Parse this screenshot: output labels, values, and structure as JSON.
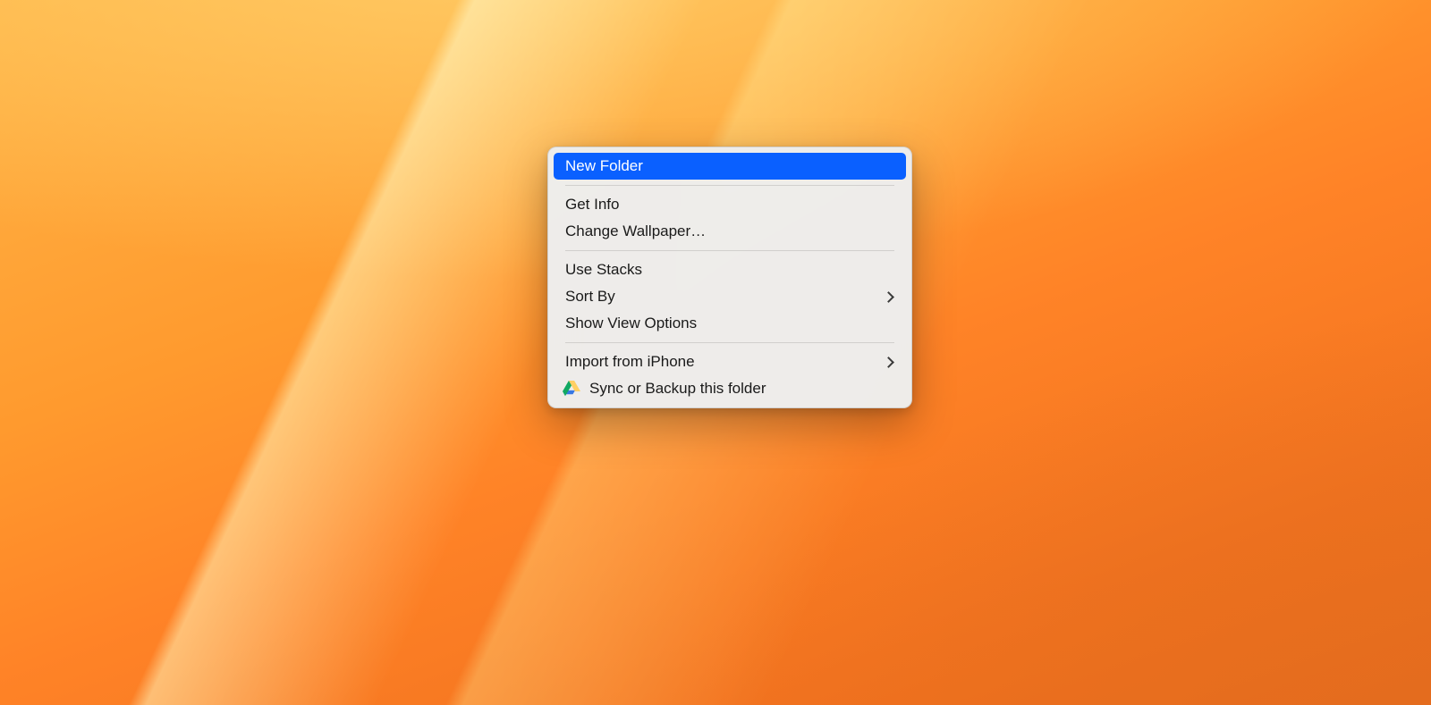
{
  "context_menu": {
    "highlighted_index": 0,
    "groups": [
      [
        {
          "id": "new-folder",
          "label": "New Folder",
          "submenu": false,
          "icon": null
        }
      ],
      [
        {
          "id": "get-info",
          "label": "Get Info",
          "submenu": false,
          "icon": null
        },
        {
          "id": "change-wallpaper",
          "label": "Change Wallpaper…",
          "submenu": false,
          "icon": null
        }
      ],
      [
        {
          "id": "use-stacks",
          "label": "Use Stacks",
          "submenu": false,
          "icon": null
        },
        {
          "id": "sort-by",
          "label": "Sort By",
          "submenu": true,
          "icon": null
        },
        {
          "id": "show-view-options",
          "label": "Show View Options",
          "submenu": false,
          "icon": null
        }
      ],
      [
        {
          "id": "import-from-iphone",
          "label": "Import from iPhone",
          "submenu": true,
          "icon": null
        },
        {
          "id": "sync-backup-folder",
          "label": "Sync or Backup this folder",
          "submenu": false,
          "icon": "google-drive"
        }
      ]
    ]
  },
  "colors": {
    "menu_highlight": "#0a60ff",
    "menu_bg": "#eeeeee",
    "text": "#1a1a1a"
  }
}
